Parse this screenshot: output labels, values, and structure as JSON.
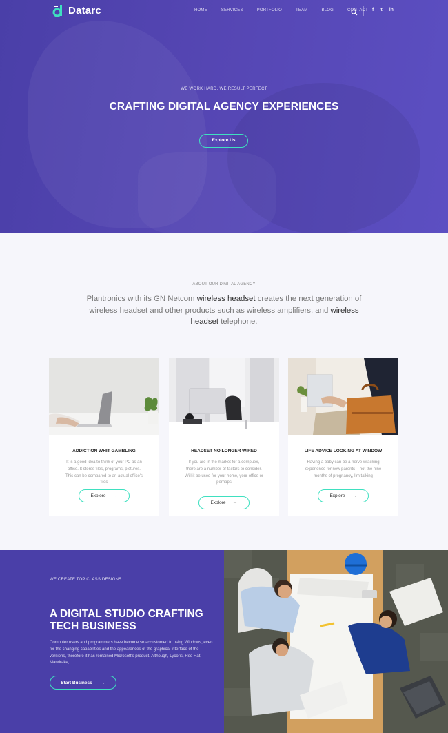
{
  "brand": {
    "name": "Datarc",
    "accent": "#3fe0c0",
    "primary": "#4a3fa8"
  },
  "nav": {
    "items": [
      "HOME",
      "SERVICES",
      "PORTFOLIO",
      "TEAM",
      "BLOG",
      "CONTACT"
    ],
    "social": [
      "f",
      "t",
      "in"
    ]
  },
  "hero": {
    "kicker": "WE WORK HARD, WE RESULT PERFECT",
    "title": "CRAFTING DIGITAL AGENCY EXPERIENCES",
    "button": "Explore Us"
  },
  "about": {
    "kicker": "ABOUT OUR DIGITAL AGENCY",
    "text_parts": [
      "Plantronics with its GN Netcom ",
      "wireless headset",
      " creates the next generation of wireless headset and other products such as wireless amplifiers, and ",
      "wireless headset",
      " telephone."
    ]
  },
  "cards": [
    {
      "title": "ADDICTION WHIT GAMBLING",
      "text": "It is a good idea to think of your PC as an office. It stores files, programs, pictures. This can be compared to an actual office's files",
      "button": "Explore"
    },
    {
      "title": "HEADSET NO LONGER WIRED",
      "text": "If you are in the market for a computer, there are a number of factors to consider. Will it be used for your home, your office or perhaps",
      "button": "Explore"
    },
    {
      "title": "LIFE ADVICE LOOKING AT WINDOW",
      "text": "Having a baby can be a nerve wracking experience for new parents – not the nine months of pregnancy, I'm talking",
      "button": "Explore"
    }
  ],
  "studio": {
    "kicker": "WE CREATE TOP CLASS DESIGNS",
    "title_line1": "A DIGITAL STUDIO CRAFTING",
    "title_line2": "TECH BUSINESS",
    "text": "Computer users and programmers have become so accustomed to using Windows, even for the changing capabilities and the appearances of the graphical interface of the versions, therefore it has remained Microsoft's product. Although, Lycoris, Red Hat, Mandrake,",
    "button": "Start Business"
  }
}
